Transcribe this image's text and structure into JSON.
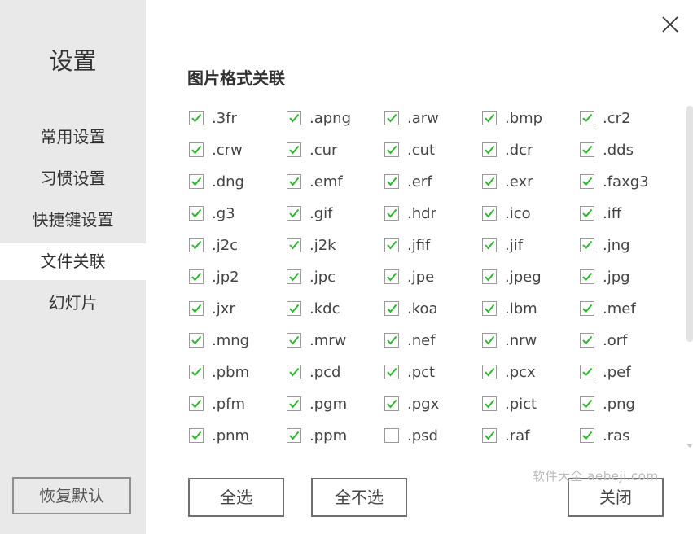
{
  "sidebar": {
    "title": "设置",
    "items": [
      {
        "label": "常用设置",
        "active": false
      },
      {
        "label": "习惯设置",
        "active": false
      },
      {
        "label": "快捷键设置",
        "active": false
      },
      {
        "label": "文件关联",
        "active": true
      },
      {
        "label": "幻灯片",
        "active": false
      }
    ],
    "reset_label": "恢复默认"
  },
  "main": {
    "section_title": "图片格式关联",
    "formats": [
      {
        "ext": ".3fr",
        "checked": true
      },
      {
        "ext": ".apng",
        "checked": true
      },
      {
        "ext": ".arw",
        "checked": true
      },
      {
        "ext": ".bmp",
        "checked": true
      },
      {
        "ext": ".cr2",
        "checked": true
      },
      {
        "ext": ".crw",
        "checked": true
      },
      {
        "ext": ".cur",
        "checked": true
      },
      {
        "ext": ".cut",
        "checked": true
      },
      {
        "ext": ".dcr",
        "checked": true
      },
      {
        "ext": ".dds",
        "checked": true
      },
      {
        "ext": ".dng",
        "checked": true
      },
      {
        "ext": ".emf",
        "checked": true
      },
      {
        "ext": ".erf",
        "checked": true
      },
      {
        "ext": ".exr",
        "checked": true
      },
      {
        "ext": ".faxg3",
        "checked": true
      },
      {
        "ext": ".g3",
        "checked": true
      },
      {
        "ext": ".gif",
        "checked": true
      },
      {
        "ext": ".hdr",
        "checked": true
      },
      {
        "ext": ".ico",
        "checked": true
      },
      {
        "ext": ".iff",
        "checked": true
      },
      {
        "ext": ".j2c",
        "checked": true
      },
      {
        "ext": ".j2k",
        "checked": true
      },
      {
        "ext": ".jfif",
        "checked": true
      },
      {
        "ext": ".jif",
        "checked": true
      },
      {
        "ext": ".jng",
        "checked": true
      },
      {
        "ext": ".jp2",
        "checked": true
      },
      {
        "ext": ".jpc",
        "checked": true
      },
      {
        "ext": ".jpe",
        "checked": true
      },
      {
        "ext": ".jpeg",
        "checked": true
      },
      {
        "ext": ".jpg",
        "checked": true
      },
      {
        "ext": ".jxr",
        "checked": true
      },
      {
        "ext": ".kdc",
        "checked": true
      },
      {
        "ext": ".koa",
        "checked": true
      },
      {
        "ext": ".lbm",
        "checked": true
      },
      {
        "ext": ".mef",
        "checked": true
      },
      {
        "ext": ".mng",
        "checked": true
      },
      {
        "ext": ".mrw",
        "checked": true
      },
      {
        "ext": ".nef",
        "checked": true
      },
      {
        "ext": ".nrw",
        "checked": true
      },
      {
        "ext": ".orf",
        "checked": true
      },
      {
        "ext": ".pbm",
        "checked": true
      },
      {
        "ext": ".pcd",
        "checked": true
      },
      {
        "ext": ".pct",
        "checked": true
      },
      {
        "ext": ".pcx",
        "checked": true
      },
      {
        "ext": ".pef",
        "checked": true
      },
      {
        "ext": ".pfm",
        "checked": true
      },
      {
        "ext": ".pgm",
        "checked": true
      },
      {
        "ext": ".pgx",
        "checked": true
      },
      {
        "ext": ".pict",
        "checked": true
      },
      {
        "ext": ".png",
        "checked": true
      },
      {
        "ext": ".pnm",
        "checked": true
      },
      {
        "ext": ".ppm",
        "checked": true
      },
      {
        "ext": ".psd",
        "checked": false
      },
      {
        "ext": ".raf",
        "checked": true
      },
      {
        "ext": ".ras",
        "checked": true
      }
    ]
  },
  "buttons": {
    "select_all": "全选",
    "select_none": "全不选",
    "close": "关闭"
  },
  "watermark": "软件大全 aebeji.com",
  "icons": {
    "check": "check-icon",
    "close": "close-icon"
  },
  "colors": {
    "check_green": "#2fb52f",
    "sidebar_bg": "#e9e9e9",
    "active_bg": "#ffffff"
  }
}
